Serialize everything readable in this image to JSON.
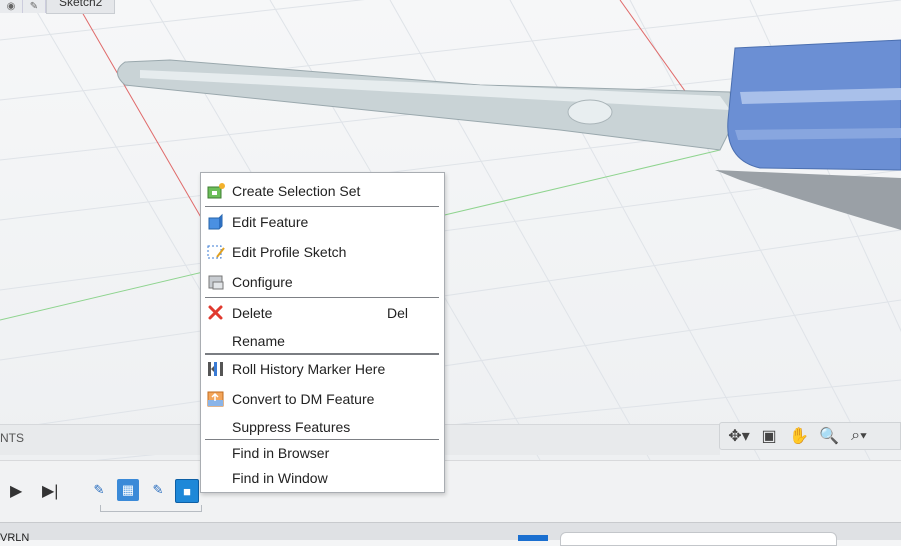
{
  "document": {
    "sketch_tab": "Sketch2"
  },
  "browser_panel": {
    "section_label": "NTS"
  },
  "context_menu": {
    "items": [
      {
        "label": "Create Selection Set",
        "icon": "selection-set-icon",
        "shortcut": ""
      },
      {
        "label": "Edit Feature",
        "icon": "edit-feature-icon",
        "shortcut": ""
      },
      {
        "label": "Edit Profile Sketch",
        "icon": "edit-profile-sketch-icon",
        "shortcut": ""
      },
      {
        "label": "Configure",
        "icon": "configure-icon",
        "shortcut": ""
      },
      {
        "label": "Delete",
        "icon": "delete-x-icon",
        "shortcut": "Del"
      },
      {
        "label": "Rename",
        "icon": "",
        "shortcut": ""
      },
      {
        "label": "Roll History Marker Here",
        "icon": "roll-history-icon",
        "shortcut": ""
      },
      {
        "label": "Convert to DM Feature",
        "icon": "convert-dm-icon",
        "shortcut": ""
      },
      {
        "label": "Suppress Features",
        "icon": "",
        "shortcut": ""
      },
      {
        "label": "Find in Browser",
        "icon": "",
        "shortcut": ""
      },
      {
        "label": "Find in Window",
        "icon": "",
        "shortcut": ""
      }
    ]
  },
  "nav_toolbar": {
    "tools": [
      "orbit-icon",
      "look-at-icon",
      "pan-icon",
      "zoom-window-icon",
      "fit-zoom-icon"
    ]
  },
  "timeline": {
    "items": [
      "sketch-icon",
      "canvas-image-icon",
      "sketch-icon",
      "feature-body-icon"
    ]
  },
  "status_bar": {
    "left_text": "VRLN"
  },
  "colors": {
    "handle_blue": "#6b8fd4",
    "menu_delete_red": "#e03a2f",
    "timeline_selected": "#1e88d8"
  }
}
